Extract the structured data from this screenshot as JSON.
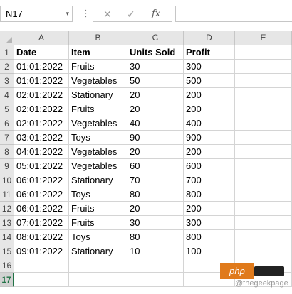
{
  "formula_bar": {
    "name_box": "N17",
    "dropdown_glyph": "▾",
    "dots_glyph": "⋮",
    "cancel_glyph": "✕",
    "enter_glyph": "✓",
    "fx_label": "fx",
    "formula_value": ""
  },
  "columns": [
    "A",
    "B",
    "C",
    "D",
    "E"
  ],
  "rows": [
    {
      "n": "1",
      "cells": [
        "Date",
        "Item",
        "Units Sold",
        "Profit",
        ""
      ]
    },
    {
      "n": "2",
      "cells": [
        "01:01:2022",
        "Fruits",
        "30",
        "300",
        ""
      ]
    },
    {
      "n": "3",
      "cells": [
        "01:01:2022",
        "Vegetables",
        "50",
        "500",
        ""
      ]
    },
    {
      "n": "4",
      "cells": [
        "02:01:2022",
        "Stationary",
        "20",
        "200",
        ""
      ]
    },
    {
      "n": "5",
      "cells": [
        "02:01:2022",
        "Fruits",
        "20",
        "200",
        ""
      ]
    },
    {
      "n": "6",
      "cells": [
        "02:01:2022",
        "Vegetables",
        "40",
        "400",
        ""
      ]
    },
    {
      "n": "7",
      "cells": [
        "03:01:2022",
        "Toys",
        "90",
        "900",
        ""
      ]
    },
    {
      "n": "8",
      "cells": [
        "04:01:2022",
        "Vegetables",
        "20",
        "200",
        ""
      ]
    },
    {
      "n": "9",
      "cells": [
        "05:01:2022",
        "Vegetables",
        "60",
        "600",
        ""
      ]
    },
    {
      "n": "10",
      "cells": [
        "06:01:2022",
        "Stationary",
        "70",
        "700",
        ""
      ]
    },
    {
      "n": "11",
      "cells": [
        "06:01:2022",
        "Toys",
        "80",
        "800",
        ""
      ]
    },
    {
      "n": "12",
      "cells": [
        "06:01:2022",
        "Fruits",
        "20",
        "200",
        ""
      ]
    },
    {
      "n": "13",
      "cells": [
        "07:01:2022",
        "Fruits",
        "30",
        "300",
        ""
      ]
    },
    {
      "n": "14",
      "cells": [
        "08:01:2022",
        "Toys",
        "80",
        "800",
        ""
      ]
    },
    {
      "n": "15",
      "cells": [
        "09:01:2022",
        "Stationary",
        "10",
        "100",
        ""
      ]
    },
    {
      "n": "16",
      "cells": [
        "",
        "",
        "",
        "",
        ""
      ]
    },
    {
      "n": "17",
      "cells": [
        "",
        "",
        "",
        "",
        ""
      ]
    }
  ],
  "active_row": "17",
  "watermark": "@thegeekpage",
  "badge": "php",
  "colors": {
    "accent": "#217346",
    "header_bg": "#e6e6e6",
    "grid_line": "#d4d4d4"
  }
}
